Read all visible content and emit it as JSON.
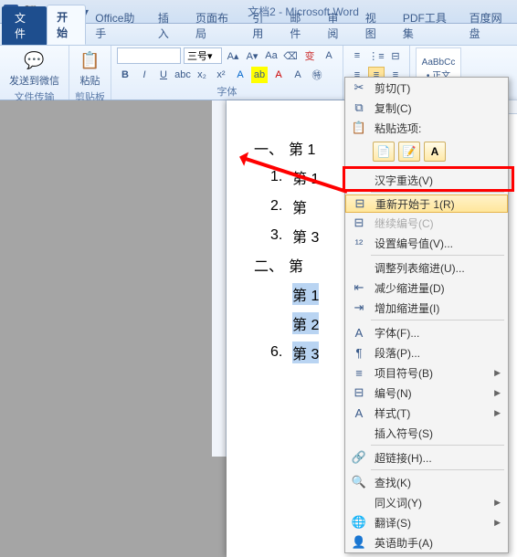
{
  "title": "文档2 - Microsoft Word",
  "tabs": {
    "file": "文件",
    "home": "开始",
    "office_assistant": "Office助手",
    "insert": "插入",
    "layout": "页面布局",
    "references": "引用",
    "mail": "邮件",
    "review": "审阅",
    "view": "视图",
    "pdf": "PDF工具集",
    "baidu": "百度网盘"
  },
  "ribbon": {
    "wechat_label": "发送到微信",
    "paste_label": "粘贴",
    "group_transfer": "文件传输",
    "group_clipboard": "剪贴板",
    "group_font": "字体",
    "font_size": "三号",
    "style1": "AaBbCc",
    "style1_label": "• 正文"
  },
  "document": {
    "l1_prefix": "一、",
    "l1_text": "第 1",
    "l2_prefix": "1.",
    "l2_text": "第 1",
    "l3_prefix": "2.",
    "l3_text": "第",
    "l4_prefix": "3.",
    "l4_text": "第 3",
    "l5_prefix": "二、",
    "l5_text": "第",
    "l6_prefix": "",
    "l6_text": "第 1",
    "l7_prefix": "",
    "l7_text": "第 2",
    "l8_prefix": "6.",
    "l8_text": "第 3"
  },
  "ctx": {
    "cut": "剪切(T)",
    "copy": "复制(C)",
    "paste_options": "粘贴选项:",
    "hanzi": "汉字重选(V)",
    "restart": "重新开始于 1(R)",
    "continue": "继续编号(C)",
    "set_value": "设置编号值(V)...",
    "adjust_indent": "调整列表缩进(U)...",
    "dec_indent": "减少缩进量(D)",
    "inc_indent": "增加缩进量(I)",
    "font": "字体(F)...",
    "paragraph": "段落(P)...",
    "bullets": "项目符号(B)",
    "numbering": "编号(N)",
    "styles": "样式(T)",
    "insert_symbol": "插入符号(S)",
    "hyperlink": "超链接(H)...",
    "lookup": "查找(K)",
    "synonyms": "同义词(Y)",
    "translate": "翻译(S)",
    "assistant": "英语助手(A)"
  }
}
